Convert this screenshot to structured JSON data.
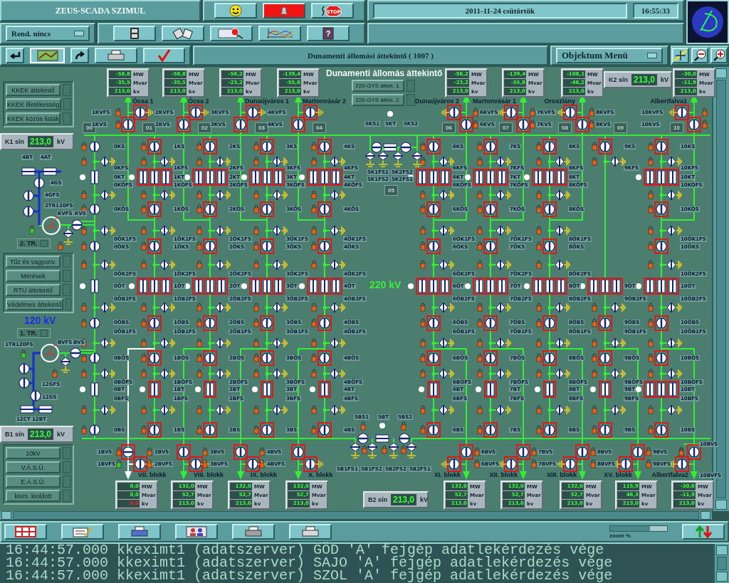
{
  "header": {
    "title": "ZEUS-SCADA SZIMUL",
    "stop_label": "STOP",
    "help_glyph": "?",
    "date": "2011-11-24  csütörtök",
    "time": "16:55:33"
  },
  "toolbar": {
    "dropdown": "Rend. nincs",
    "view_title": "Dunamenti állomási áttekintő ( 1007 )",
    "object_menu": "Objektum Menü"
  },
  "left_menu": {
    "groups": [
      [
        "KKEK áttekintő",
        "KKEK illetékesség",
        "KKEK közös listák"
      ],
      [
        "Tűz és vagyonv.",
        "Mérések",
        "RTU áttekintő",
        "Védelmes áttekintő"
      ],
      [
        "10kV",
        "V.Á.S.Ü.",
        "E.Á.S.Ü.",
        "kism. kioldott"
      ]
    ]
  },
  "k1_bus": {
    "label": "K1 sín",
    "value": "213,0",
    "unit": "kV"
  },
  "transformer_2": {
    "name": "2. TR.",
    "highlighted": false,
    "labels": [
      "4BT",
      "4AT",
      "4GS",
      "4GFS",
      "2TR120FS",
      "KVFS",
      "KVS"
    ]
  },
  "transformer_1": {
    "voltage": "120 kV",
    "name": "1. TR.",
    "highlighted": false,
    "labels": [
      "1TR120FS",
      "BVFS",
      "BVS",
      "12GFS",
      "12GS",
      "12CT",
      "12BT"
    ]
  },
  "b1_bus": {
    "label": "B1 sín",
    "value": "213,0",
    "unit": "kV"
  },
  "diagram": {
    "title": "Dunamenti állomás áttekintő",
    "voltage": "220 kV",
    "links": [
      "220-GYS áttek. 1.",
      "220-GYS áttek. 2."
    ]
  },
  "k2_bus": {
    "label": "K2 sín",
    "value": "213,0",
    "unit": "kV"
  },
  "b2_bus": {
    "label": "B2 sín",
    "value": "213,0",
    "unit": "kV"
  },
  "bays": [
    {
      "number": "00",
      "highlighted": false,
      "elements": [
        {
          "kind": "KS",
          "label": "0KS"
        },
        {
          "kind": "KFS",
          "label": "0KFS"
        },
        {
          "kind": "KT",
          "label": "0KT"
        },
        {
          "kind": "KOFS",
          "label": "0KÖFS"
        },
        {
          "kind": "KOS",
          "label": "0KÖS"
        },
        {
          "kind": "OK1FS",
          "label": "0ÖK1FS"
        },
        {
          "kind": "OKS",
          "label": "0ÖKS"
        },
        {
          "kind": "OK2FS",
          "label": "0ÖK2FS"
        },
        {
          "kind": "OT",
          "label": "0ÖT"
        },
        {
          "kind": "OB2FS",
          "label": "0ÖB2FS"
        },
        {
          "kind": "OBS",
          "label": "0ÖBS"
        },
        {
          "kind": "OB1FS",
          "label": "0ÖB1FS"
        },
        {
          "kind": "BOS",
          "label": "0BÖS"
        },
        {
          "kind": "BOFS",
          "label": "0BÖFS"
        },
        {
          "kind": "BT",
          "label": "0BT"
        },
        {
          "kind": "BFS",
          "label": "0BFS"
        },
        {
          "kind": "BS",
          "label": "0BS"
        }
      ]
    },
    {
      "number": "01",
      "highlighted": true,
      "elements": [
        {
          "kind": "KS",
          "label": "1KS"
        },
        {
          "kind": "KFS",
          "label": "1KFS"
        },
        {
          "kind": "KT3",
          "label": "1KT"
        },
        {
          "kind": "KOFS",
          "label": "1KÖFS"
        },
        {
          "kind": "KOS",
          "label": "1KÖS"
        },
        {
          "kind": "OK1FS",
          "label": "1ÖK1FS"
        },
        {
          "kind": "OKS",
          "label": "1ÖKS"
        },
        {
          "kind": "OK2FS",
          "label": "1ÖK2FS"
        },
        {
          "kind": "OT3",
          "label": "1ÖT"
        },
        {
          "kind": "OB2FS",
          "label": "1ÖB2FS"
        },
        {
          "kind": "OBS",
          "label": "1ÖBS"
        },
        {
          "kind": "OB1FS",
          "label": "1ÖB1FS"
        },
        {
          "kind": "BOS",
          "label": "1BÖS"
        },
        {
          "kind": "BOFS",
          "label": "1BÖFS"
        },
        {
          "kind": "BT",
          "label": "1BT"
        },
        {
          "kind": "BFS",
          "label": "1BFS"
        },
        {
          "kind": "BS",
          "label": "1BS"
        }
      ],
      "top_feeder": {
        "name": "Ócsa 1",
        "energized": true,
        "labels_left": [
          "1KVFS",
          "1KVS"
        ],
        "labels_right": [
          "2KVFS",
          "2KVS"
        ],
        "meter": [
          {
            "value": "-58,8",
            "unit": "MW",
            "alarm": false
          },
          {
            "value": "-35,5",
            "unit": "Mvar",
            "alarm": false
          },
          {
            "value": "213,0",
            "unit": "kv",
            "alarm": false
          }
        ]
      },
      "bottom_feeder": {
        "name": "VII. blokk",
        "energized": false,
        "labels_left": [
          "1BVS",
          "1BVFS"
        ],
        "labels_right": [
          "2BVS",
          "2BVFS"
        ],
        "meter": [
          {
            "value": "0,0",
            "unit": "MW",
            "alarm": false
          },
          {
            "value": "0,0",
            "unit": "Mvar",
            "alarm": false
          },
          {
            "value": "0,0",
            "unit": "kv",
            "alarm": true
          }
        ]
      }
    },
    {
      "number": "02",
      "highlighted": true,
      "elements": [
        {
          "kind": "KS",
          "label": "2KS"
        },
        {
          "kind": "KFS",
          "label": "2KFS"
        },
        {
          "kind": "KT3",
          "label": "2KT"
        },
        {
          "kind": "KOFS",
          "label": "2KÖFS"
        },
        {
          "kind": "KOS",
          "label": "2KÖS"
        },
        {
          "kind": "OK1FS",
          "label": "2ÖK1FS"
        },
        {
          "kind": "OKS",
          "label": "2ÖKS"
        },
        {
          "kind": "OK2FS",
          "label": "2ÖK2FS"
        },
        {
          "kind": "OT3",
          "label": "2ÖT"
        },
        {
          "kind": "OB2FS",
          "label": "2ÖB2FS"
        },
        {
          "kind": "OBS",
          "label": "2ÖBS"
        },
        {
          "kind": "OB1FS",
          "label": "2ÖB1FS"
        },
        {
          "kind": "BOS",
          "label": "2BÖS"
        },
        {
          "kind": "BOFS",
          "label": "2BÖFS"
        },
        {
          "kind": "BT",
          "label": "2BT"
        },
        {
          "kind": "BFS",
          "label": "2BFS"
        },
        {
          "kind": "BS",
          "label": "2BS"
        }
      ],
      "top_feeder": {
        "name": "Ócsa 2",
        "energized": true,
        "labels_right": [
          "3KVFS",
          "3KVS"
        ],
        "meter": [
          {
            "value": "-58,8",
            "unit": "MW",
            "alarm": false
          },
          {
            "value": "-35,5",
            "unit": "Mvar",
            "alarm": false
          },
          {
            "value": "213,0",
            "unit": "kv",
            "alarm": false
          }
        ]
      },
      "bottom_feeder": {
        "name": "VIII. blokk",
        "energized": true,
        "labels_right": [
          "3BVS",
          "3BVFS"
        ],
        "meter": [
          {
            "value": "132,0",
            "unit": "MW",
            "alarm": false
          },
          {
            "value": "52,7",
            "unit": "Mvar",
            "alarm": false
          },
          {
            "value": "213,0",
            "unit": "kv",
            "alarm": false
          }
        ]
      }
    },
    {
      "number": "03",
      "highlighted": true,
      "elements": [
        {
          "kind": "KS",
          "label": "3KS"
        },
        {
          "kind": "KFS",
          "label": "3KFS"
        },
        {
          "kind": "KT3",
          "label": "3KT"
        },
        {
          "kind": "KOFS",
          "label": "3KÖFS"
        },
        {
          "kind": "KOS",
          "label": "3KÖS"
        },
        {
          "kind": "OK1FS",
          "label": "3ÖK1FS"
        },
        {
          "kind": "OKS",
          "label": "3ÖKS"
        },
        {
          "kind": "OK2FS",
          "label": "3ÖK2FS"
        },
        {
          "kind": "OT3",
          "label": "3ÖT"
        },
        {
          "kind": "OB2FS",
          "label": "3ÖB2FS"
        },
        {
          "kind": "OBS",
          "label": "3ÖBS"
        },
        {
          "kind": "OB1FS",
          "label": "3ÖB1FS"
        },
        {
          "kind": "BOS",
          "label": "3BÖS"
        },
        {
          "kind": "BOFS",
          "label": "3BÖFS"
        },
        {
          "kind": "BT",
          "label": "3BT"
        },
        {
          "kind": "BFS",
          "label": "3BFS"
        },
        {
          "kind": "BS",
          "label": "3BS"
        }
      ],
      "top_feeder": {
        "name": "Dunaújváros 1",
        "energized": true,
        "labels_right": [
          "4KVFS",
          "4KVS"
        ],
        "meter": [
          {
            "value": "-56,2",
            "unit": "MW",
            "alarm": false
          },
          {
            "value": "-23,2",
            "unit": "Mvar",
            "alarm": false
          },
          {
            "value": "213,0",
            "unit": "kv",
            "alarm": false
          }
        ]
      },
      "bottom_feeder": {
        "name": "IX. blokk",
        "energized": true,
        "labels_right": [
          "4BVS",
          "4BVFS"
        ],
        "meter": [
          {
            "value": "132,0",
            "unit": "MW",
            "alarm": false
          },
          {
            "value": "52,7",
            "unit": "Mvar",
            "alarm": false
          },
          {
            "value": "213,0",
            "unit": "kv",
            "alarm": false
          }
        ]
      }
    },
    {
      "number": "04",
      "highlighted": true,
      "elements": [
        {
          "kind": "KS",
          "label": "4KS"
        },
        {
          "kind": "KFS",
          "label": "4KFS"
        },
        {
          "kind": "KT3",
          "label": "4KT"
        },
        {
          "kind": "KOFS",
          "label": "4KÖFS"
        },
        {
          "kind": "KOS",
          "label": "4KÖS"
        },
        {
          "kind": "OK1FS",
          "label": "4ÖK1FS"
        },
        {
          "kind": "OKS",
          "label": "4ÖKS"
        },
        {
          "kind": "OK2FS",
          "label": "4ÖK2FS"
        },
        {
          "kind": "OT3",
          "label": "4ÖT"
        },
        {
          "kind": "OB2FS",
          "label": "4ÖB2FS"
        },
        {
          "kind": "OBS",
          "label": "4ÖBS"
        },
        {
          "kind": "OB1FS",
          "label": "4ÖB1FS"
        },
        {
          "kind": "BOS",
          "label": "4BÖS"
        },
        {
          "kind": "BOFS",
          "label": "4BÖFS"
        },
        {
          "kind": "BT",
          "label": "4BT"
        },
        {
          "kind": "BFS",
          "label": "4BFS"
        },
        {
          "kind": "BS",
          "label": "4BS"
        }
      ],
      "top_feeder": {
        "name": "Martonvásár 2",
        "energized": true,
        "meter": [
          {
            "value": "-139,4",
            "unit": "MW",
            "alarm": false
          },
          {
            "value": "-55,8",
            "unit": "Mvar",
            "alarm": false
          },
          {
            "value": "213,0",
            "unit": "kv",
            "alarm": false
          }
        ]
      },
      "bottom_feeder": {
        "name": "X. blokk",
        "energized": true,
        "meter": [
          {
            "value": "132,0",
            "unit": "MW",
            "alarm": false
          },
          {
            "value": "52,7",
            "unit": "Mvar",
            "alarm": false
          },
          {
            "value": "213,0",
            "unit": "kv",
            "alarm": false
          }
        ]
      }
    },
    {
      "number": "06",
      "highlighted": true,
      "elements": [
        {
          "kind": "KS",
          "label": "6KS"
        },
        {
          "kind": "KFS",
          "label": "6KFS"
        },
        {
          "kind": "KT3",
          "label": "6KT"
        },
        {
          "kind": "KOFS",
          "label": "6KÖFS"
        },
        {
          "kind": "KOS",
          "label": "6KÖS"
        },
        {
          "kind": "OK1FS",
          "label": "6ÖK1FS"
        },
        {
          "kind": "OKS",
          "label": "6ÖKS"
        },
        {
          "kind": "OK2FS",
          "label": "6ÖK2FS"
        },
        {
          "kind": "OT3",
          "label": "6ÖT"
        },
        {
          "kind": "OB2FS",
          "label": "6ÖB2FS"
        },
        {
          "kind": "OBS",
          "label": "6ÖBS"
        },
        {
          "kind": "OB1FS",
          "label": "6ÖB1FS"
        },
        {
          "kind": "BOS",
          "label": "6BÖS"
        },
        {
          "kind": "BOFS",
          "label": "6BÖFS"
        },
        {
          "kind": "BT",
          "label": "6BT"
        },
        {
          "kind": "BFS",
          "label": "6BFS"
        },
        {
          "kind": "BS",
          "label": "6BS"
        }
      ],
      "top_feeder": {
        "name": "Dunaújváros 2",
        "energized": true,
        "labels_right": [
          "6KVFS",
          "6KVS"
        ],
        "meter": [
          {
            "value": "-56,2",
            "unit": "MW",
            "alarm": false
          },
          {
            "value": "-23,2",
            "unit": "Mvar",
            "alarm": false
          },
          {
            "value": "213,0",
            "unit": "kv",
            "alarm": false
          }
        ]
      },
      "bottom_feeder": {
        "name": "XI. blokk",
        "energized": true,
        "labels_right": [
          "6BVS",
          "6BVFS"
        ],
        "meter": [
          {
            "value": "132,0",
            "unit": "MW",
            "alarm": false
          },
          {
            "value": "52,7",
            "unit": "Mvar",
            "alarm": false
          },
          {
            "value": "213,0",
            "unit": "kv",
            "alarm": false
          }
        ]
      }
    },
    {
      "number": "07",
      "highlighted": true,
      "elements": [
        {
          "kind": "KS",
          "label": "7KS"
        },
        {
          "kind": "KFS",
          "label": "7KFS"
        },
        {
          "kind": "KT3",
          "label": "7KT"
        },
        {
          "kind": "KOFS",
          "label": "7KÖFS"
        },
        {
          "kind": "KOS",
          "label": "7KÖS"
        },
        {
          "kind": "OK1FS",
          "label": "7ÖK1FS"
        },
        {
          "kind": "OKS",
          "label": "7ÖKS"
        },
        {
          "kind": "OK2FS",
          "label": "7ÖK2FS"
        },
        {
          "kind": "OT3",
          "label": "7ÖT"
        },
        {
          "kind": "OB2FS",
          "label": "7ÖB2FS"
        },
        {
          "kind": "OBS",
          "label": "7ÖBS"
        },
        {
          "kind": "OB1FS",
          "label": "7ÖB1FS"
        },
        {
          "kind": "BOS",
          "label": "7BÖS"
        },
        {
          "kind": "BOFS",
          "label": "7BÖFS"
        },
        {
          "kind": "BT",
          "label": "7BT"
        },
        {
          "kind": "BFS",
          "label": "7BFS"
        },
        {
          "kind": "BS",
          "label": "7BS"
        }
      ],
      "top_feeder": {
        "name": "Martonvásár 1",
        "energized": true,
        "labels_right": [
          "7KVFS",
          "7KVS"
        ],
        "meter": [
          {
            "value": "-139,4",
            "unit": "MW",
            "alarm": false
          },
          {
            "value": "-55,8",
            "unit": "Mvar",
            "alarm": false
          },
          {
            "value": "213,0",
            "unit": "kv",
            "alarm": false
          }
        ]
      },
      "bottom_feeder": {
        "name": "XII. blokk",
        "energized": true,
        "labels_right": [
          "7BVS",
          "7BVFS"
        ],
        "meter": [
          {
            "value": "132,0",
            "unit": "MW",
            "alarm": false
          },
          {
            "value": "52,7",
            "unit": "Mvar",
            "alarm": false
          },
          {
            "value": "213,0",
            "unit": "kv",
            "alarm": false
          }
        ]
      }
    },
    {
      "number": "08",
      "highlighted": true,
      "elements": [
        {
          "kind": "KS",
          "label": "8KS"
        },
        {
          "kind": "KFS",
          "label": "8KFS"
        },
        {
          "kind": "KT3",
          "label": "8KT"
        },
        {
          "kind": "KOFS",
          "label": "8KÖFS"
        },
        {
          "kind": "KOS",
          "label": "8KÖS"
        },
        {
          "kind": "OK1FS",
          "label": "8ÖK1FS"
        },
        {
          "kind": "OKS",
          "label": "8ÖKS"
        },
        {
          "kind": "OK2FS",
          "label": "8ÖK2FS"
        },
        {
          "kind": "OT3",
          "label": "8ÖT"
        },
        {
          "kind": "OB2FS",
          "label": "8ÖB2FS"
        },
        {
          "kind": "OBS",
          "label": "8ÖBS"
        },
        {
          "kind": "OB1FS",
          "label": "8ÖB1FS"
        },
        {
          "kind": "BOS",
          "label": "8BÖS"
        },
        {
          "kind": "BOFS",
          "label": "8BÖFS"
        },
        {
          "kind": "BT",
          "label": "8BT"
        },
        {
          "kind": "BFS",
          "label": "8BFS"
        },
        {
          "kind": "BS",
          "label": "8BS"
        }
      ],
      "top_feeder": {
        "name": "Oroszlány",
        "energized": true,
        "labels_right": [
          "8KVFS",
          "8KVS"
        ],
        "meter": [
          {
            "value": "-108,1",
            "unit": "MW",
            "alarm": false
          },
          {
            "value": "-48,2",
            "unit": "Mvar",
            "alarm": false
          },
          {
            "value": "213,0",
            "unit": "kv",
            "alarm": false
          }
        ]
      },
      "bottom_feeder": {
        "name": "XIII. blokk",
        "energized": true,
        "labels_right": [
          "8BVS",
          "8BVFS"
        ],
        "meter": [
          {
            "value": "132,0",
            "unit": "MW",
            "alarm": false
          },
          {
            "value": "52,7",
            "unit": "Mvar",
            "alarm": false
          },
          {
            "value": "213,0",
            "unit": "kv",
            "alarm": false
          }
        ]
      }
    },
    {
      "number": "09",
      "highlighted": true,
      "elements": [
        {
          "kind": "KS",
          "label": "9KS"
        },
        {
          "kind": "KFS",
          "label": "9KFS"
        },
        {
          "kind": "OT3",
          "label": "9ÖT"
        },
        {
          "kind": "OB2FS",
          "label": "9ÖB2FS"
        },
        {
          "kind": "OBS",
          "label": "9ÖBS"
        },
        {
          "kind": "OB1FS",
          "label": "9ÖB1FS"
        },
        {
          "kind": "BOS",
          "label": "9BÖS"
        },
        {
          "kind": "BOFS",
          "label": "9BÖFS"
        },
        {
          "kind": "BT",
          "label": "9BT"
        },
        {
          "kind": "BFS",
          "label": "9BFS"
        },
        {
          "kind": "BS",
          "label": "9BS"
        }
      ],
      "bottom_feeder": {
        "name": "XV. blokk",
        "energized": true,
        "labels_right": [
          "9BVS",
          "9BVFS"
        ],
        "meter": [
          {
            "value": "115,9",
            "unit": "MW",
            "alarm": false
          },
          {
            "value": "46,3",
            "unit": "Mvar",
            "alarm": false
          },
          {
            "value": "213,0",
            "unit": "kv",
            "alarm": false
          }
        ]
      }
    },
    {
      "number": "10",
      "highlighted": true,
      "elements": [
        {
          "kind": "KS",
          "label": "10KS"
        },
        {
          "kind": "KFS",
          "label": "10KFS"
        },
        {
          "kind": "KT3",
          "label": "10KT"
        },
        {
          "kind": "KOFS",
          "label": "10KÖFS"
        },
        {
          "kind": "KOS",
          "label": "10KÖS"
        },
        {
          "kind": "OK1FS",
          "label": "10ÖK1FS"
        },
        {
          "kind": "OKS",
          "label": "10ÖKS"
        },
        {
          "kind": "OK2FS",
          "label": "10ÖK2FS"
        },
        {
          "kind": "OT3",
          "label": "10ÖT"
        },
        {
          "kind": "OB2FS",
          "label": "10ÖB2FS"
        },
        {
          "kind": "OBS",
          "label": "10ÖBS"
        },
        {
          "kind": "OB1FS",
          "label": "10ÖB1FS"
        },
        {
          "kind": "BOS",
          "label": "10BÖS"
        },
        {
          "kind": "BOFS",
          "label": "10BÖFS"
        },
        {
          "kind": "BT3",
          "label": "10BT"
        },
        {
          "kind": "BFS",
          "label": "10BFS"
        },
        {
          "kind": "BS",
          "label": "10BS"
        }
      ],
      "top_feeder": {
        "name": "Albertfalva1",
        "energized": true,
        "labels_left": [
          "10KVFS",
          "10KVS"
        ],
        "meter": [
          {
            "value": "-30,0",
            "unit": "MW",
            "alarm": false
          },
          {
            "value": "-11,9",
            "unit": "Mvar",
            "alarm": false
          },
          {
            "value": "213,0",
            "unit": "kv",
            "alarm": false
          }
        ]
      },
      "bottom_feeder": {
        "name": "Albertfalva2",
        "energized": true,
        "labels_right": [
          "10BVS",
          "10BVFS"
        ],
        "meter": [
          {
            "value": "-30,0",
            "unit": "MW",
            "alarm": false
          },
          {
            "value": "-11,9",
            "unit": "Mvar",
            "alarm": false
          },
          {
            "value": "213,0",
            "unit": "kv",
            "alarm": false
          }
        ]
      }
    }
  ],
  "coupler": {
    "number": "05",
    "highlighted": false,
    "top_labels": [
      "5KS1",
      "5KT",
      "5KS2",
      "5K1FS1",
      "5K1FS2",
      "5K2FS2",
      "5K2FS1"
    ],
    "bottom_labels": [
      "5BS1",
      "5BT",
      "5BS2",
      "5B1FS1",
      "5B1FS2",
      "5B2FS2",
      "5B2FS1"
    ]
  },
  "footer": {
    "zoom": {
      "label": "zoom %",
      "level": 1
    }
  },
  "log": [
    "16:44:57.000 kkeximt1 (adatszerver) GÖD 'A' fejgép adatlekérdezés vége",
    "16:44:57.000 kkeximt1 (adatszerver) SAJO 'A' fejgép adatlekérdezés vége",
    "16:44:57.000 kkeximt1 (adatszerver) SZOL 'A' fejgép adatlekérdezés vége"
  ]
}
